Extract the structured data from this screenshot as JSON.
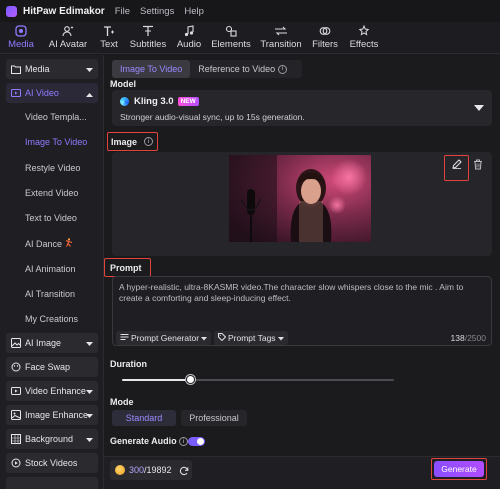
{
  "app": {
    "title": "HitPaw Edimakor",
    "menus": [
      "File",
      "Settings",
      "Help"
    ]
  },
  "toolbar": {
    "items": [
      {
        "label": "Media",
        "icon": "media-icon",
        "active": true
      },
      {
        "label": "AI Avatar",
        "icon": "avatar-icon"
      },
      {
        "label": "Text",
        "icon": "text-icon"
      },
      {
        "label": "Subtitles",
        "icon": "subtitles-icon"
      },
      {
        "label": "Audio",
        "icon": "music-note-icon"
      },
      {
        "label": "Elements",
        "icon": "elements-icon"
      },
      {
        "label": "Transition",
        "icon": "transition-icon"
      },
      {
        "label": "Filters",
        "icon": "filters-icon"
      },
      {
        "label": "Effects",
        "icon": "effects-icon"
      }
    ]
  },
  "sidebar": {
    "categories": [
      {
        "label": "Media",
        "icon": "media-icon"
      },
      {
        "label": "AI Video",
        "icon": "ai-video-icon",
        "open": true
      },
      {
        "label": "AI Image",
        "icon": "ai-image-icon"
      },
      {
        "label": "Face Swap",
        "icon": "face-swap-icon"
      },
      {
        "label": "Video Enhance",
        "icon": "video-enhance-icon"
      },
      {
        "label": "Image Enhance",
        "icon": "image-enhance-icon"
      },
      {
        "label": "Background",
        "icon": "background-icon"
      },
      {
        "label": "Stock Videos",
        "icon": "stock-videos-icon"
      }
    ],
    "ai_video_items": [
      "Video Templa...",
      "Image To Video",
      "Restyle Video",
      "Extend Video",
      "Text to Video",
      "AI Dance",
      "AI Animation",
      "AI Transition",
      "My Creations"
    ],
    "active_item": "Image To Video"
  },
  "main": {
    "tabs": [
      {
        "label": "Image To Video",
        "active": true
      },
      {
        "label": "Reference to Video",
        "active": false
      }
    ],
    "model": {
      "section_label": "Model",
      "name": "Kling 3.0",
      "badge": "NEW",
      "description": "Stronger audio-visual sync, up to 15s generation."
    },
    "image": {
      "section_label": "Image"
    },
    "prompt": {
      "section_label": "Prompt",
      "text": "A hyper-realistic, ultra-8KASMR video.The character slow whispers close to the mic . Aim to create a comforting and sleep-inducing effect.",
      "generator_label": "Prompt Generator",
      "tags_label": "Prompt Tags",
      "count": "138",
      "max": "/2500"
    },
    "duration": {
      "section_label": "Duration",
      "fraction": 0.25
    },
    "mode": {
      "section_label": "Mode",
      "options": [
        "Standard",
        "Professional"
      ],
      "selected": "Standard"
    },
    "audio": {
      "section_label": "Generate Audio",
      "enabled": true
    },
    "footer": {
      "credits_used": "300",
      "credits_total": "/19892",
      "generate_label": "Generate"
    }
  },
  "colors": {
    "accent": "#8f7bff",
    "highlight_box": "#e0443c",
    "generate": "#9a4dff"
  }
}
